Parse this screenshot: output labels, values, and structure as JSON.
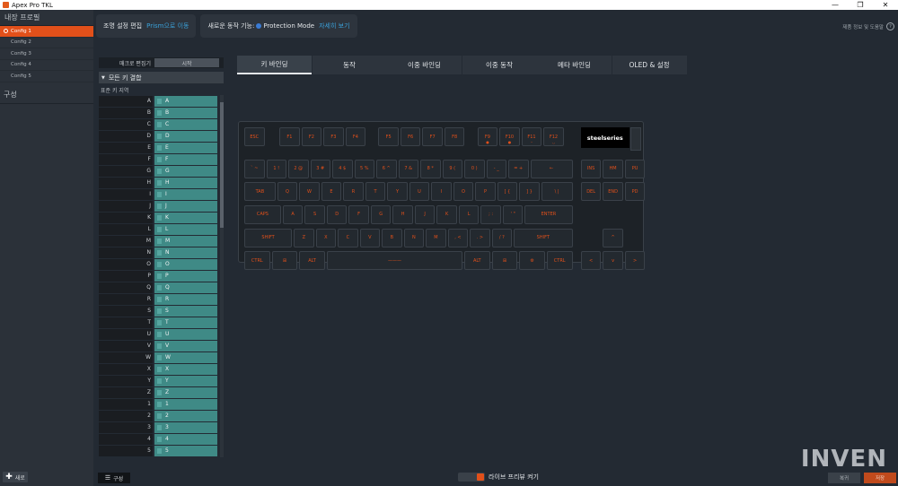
{
  "window": {
    "title": "Apex Pro TKL",
    "controls": [
      "—",
      "❐",
      "✕"
    ]
  },
  "sidebar": {
    "profiles_title": "내장 프로필",
    "configs": [
      {
        "label": "Config 1",
        "active": true
      },
      {
        "label": "Config 2",
        "active": false
      },
      {
        "label": "Config 3",
        "active": false
      },
      {
        "label": "Config 4",
        "active": false
      },
      {
        "label": "Config 5",
        "active": false
      }
    ],
    "section_config": "구성",
    "new_label": "새로"
  },
  "topbar": {
    "lighting_label": "조명 설정 편집",
    "lighting_link": "Prism으로 이동",
    "newfeature_label": "새로운 동작 기능:",
    "protection_label": "Protection Mode",
    "more_link": "자세히 보기",
    "help_label": "제품 정보 및 도움말"
  },
  "macro": {
    "editor_label": "매크로 편집기",
    "start_label": "시작",
    "combo_label": "모든 키 결합",
    "standard_label": "표준 키 지역"
  },
  "keylist": [
    {
      "key": "A",
      "bind": "A"
    },
    {
      "key": "B",
      "bind": "B"
    },
    {
      "key": "C",
      "bind": "C"
    },
    {
      "key": "D",
      "bind": "D"
    },
    {
      "key": "E",
      "bind": "E"
    },
    {
      "key": "F",
      "bind": "F"
    },
    {
      "key": "G",
      "bind": "G"
    },
    {
      "key": "H",
      "bind": "H"
    },
    {
      "key": "I",
      "bind": "I"
    },
    {
      "key": "J",
      "bind": "J"
    },
    {
      "key": "K",
      "bind": "K"
    },
    {
      "key": "L",
      "bind": "L"
    },
    {
      "key": "M",
      "bind": "M"
    },
    {
      "key": "N",
      "bind": "N"
    },
    {
      "key": "O",
      "bind": "O"
    },
    {
      "key": "P",
      "bind": "P"
    },
    {
      "key": "Q",
      "bind": "Q"
    },
    {
      "key": "R",
      "bind": "R"
    },
    {
      "key": "S",
      "bind": "S"
    },
    {
      "key": "T",
      "bind": "T"
    },
    {
      "key": "U",
      "bind": "U"
    },
    {
      "key": "V",
      "bind": "V"
    },
    {
      "key": "W",
      "bind": "W"
    },
    {
      "key": "X",
      "bind": "X"
    },
    {
      "key": "Y",
      "bind": "Y"
    },
    {
      "key": "Z",
      "bind": "Z"
    },
    {
      "key": "1",
      "bind": "1"
    },
    {
      "key": "2",
      "bind": "2"
    },
    {
      "key": "3",
      "bind": "3"
    },
    {
      "key": "4",
      "bind": "4"
    },
    {
      "key": "5",
      "bind": "5"
    }
  ],
  "tabs": [
    {
      "label": "키 바인딩",
      "active": true
    },
    {
      "label": "동작",
      "active": false
    },
    {
      "label": "이중 바인딩",
      "active": false
    },
    {
      "label": "이중 동작",
      "active": false
    },
    {
      "label": "메타 바인딩",
      "active": false
    },
    {
      "label": "OLED & 설정",
      "active": false
    }
  ],
  "keyboard": {
    "logo_text": "steelseries",
    "rows": [
      [
        {
          "label": "ESC",
          "w": 1
        },
        {
          "gap": 0.6
        },
        {
          "label": "F1",
          "w": 1
        },
        {
          "label": "F2",
          "w": 1
        },
        {
          "label": "F3",
          "w": 1
        },
        {
          "label": "F4",
          "w": 1
        },
        {
          "gap": 0.5
        },
        {
          "label": "F5",
          "w": 1
        },
        {
          "label": "F6",
          "w": 1
        },
        {
          "label": "F7",
          "w": 1
        },
        {
          "label": "F8",
          "w": 1
        },
        {
          "gap": 0.5
        },
        {
          "label": "F9",
          "w": 1,
          "sub": "●"
        },
        {
          "label": "F10",
          "w": 1,
          "sub": "●"
        },
        {
          "label": "F11",
          "w": 1,
          "sub": "–"
        },
        {
          "label": "F12",
          "w": 1,
          "sub": "◡"
        }
      ],
      [
        {
          "label": "` ~",
          "w": 1
        },
        {
          "label": "1 !",
          "w": 1
        },
        {
          "label": "2 @",
          "w": 1
        },
        {
          "label": "3 #",
          "w": 1
        },
        {
          "label": "4 $",
          "w": 1
        },
        {
          "label": "5 %",
          "w": 1
        },
        {
          "label": "6 ^",
          "w": 1
        },
        {
          "label": "7 &",
          "w": 1
        },
        {
          "label": "8 *",
          "w": 1
        },
        {
          "label": "9 (",
          "w": 1
        },
        {
          "label": "0 )",
          "w": 1
        },
        {
          "label": "- _",
          "w": 1
        },
        {
          "label": "= +",
          "w": 1
        },
        {
          "label": "←",
          "w": 2
        },
        {
          "gap": 0.3
        },
        {
          "label": "INS",
          "w": 1
        },
        {
          "label": "HM",
          "w": 1
        },
        {
          "label": "PU",
          "w": 1
        }
      ],
      [
        {
          "label": "TAB",
          "w": 1.5
        },
        {
          "label": "Q",
          "w": 1
        },
        {
          "label": "W",
          "w": 1
        },
        {
          "label": "E",
          "w": 1
        },
        {
          "label": "R",
          "w": 1
        },
        {
          "label": "T",
          "w": 1
        },
        {
          "label": "Y",
          "w": 1
        },
        {
          "label": "U",
          "w": 1
        },
        {
          "label": "I",
          "w": 1
        },
        {
          "label": "O",
          "w": 1
        },
        {
          "label": "P",
          "w": 1
        },
        {
          "label": "[ {",
          "w": 1
        },
        {
          "label": "] }",
          "w": 1
        },
        {
          "label": "\\ |",
          "w": 1.5
        },
        {
          "gap": 0.3
        },
        {
          "label": "DEL",
          "w": 1
        },
        {
          "label": "END",
          "w": 1
        },
        {
          "label": "PD",
          "w": 1
        }
      ],
      [
        {
          "label": "CAPS",
          "w": 1.75
        },
        {
          "label": "A",
          "w": 1
        },
        {
          "label": "S",
          "w": 1
        },
        {
          "label": "D",
          "w": 1
        },
        {
          "label": "F",
          "w": 1
        },
        {
          "label": "G",
          "w": 1
        },
        {
          "label": "H",
          "w": 1
        },
        {
          "label": "J",
          "w": 1
        },
        {
          "label": "K",
          "w": 1
        },
        {
          "label": "L",
          "w": 1
        },
        {
          "label": "; :",
          "w": 1
        },
        {
          "label": "' \"",
          "w": 1
        },
        {
          "label": "ENTER",
          "w": 2.25
        }
      ],
      [
        {
          "label": "SHIFT",
          "w": 2.25
        },
        {
          "label": "Z",
          "w": 1
        },
        {
          "label": "X",
          "w": 1
        },
        {
          "label": "C",
          "w": 1
        },
        {
          "label": "V",
          "w": 1
        },
        {
          "label": "B",
          "w": 1
        },
        {
          "label": "N",
          "w": 1
        },
        {
          "label": "M",
          "w": 1
        },
        {
          "label": ", <",
          "w": 1
        },
        {
          "label": ". >",
          "w": 1
        },
        {
          "label": "/ ?",
          "w": 1
        },
        {
          "label": "SHIFT",
          "w": 2.75
        },
        {
          "gap": 1.3
        },
        {
          "label": "^",
          "w": 1
        }
      ],
      [
        {
          "label": "CTRL",
          "w": 1.25
        },
        {
          "label": "⊞",
          "w": 1.25
        },
        {
          "label": "ALT",
          "w": 1.25
        },
        {
          "label": "———",
          "w": 6.25
        },
        {
          "label": "ALT",
          "w": 1.25
        },
        {
          "label": "⊞",
          "w": 1.25
        },
        {
          "label": "⚙",
          "w": 1.25
        },
        {
          "label": "CTRL",
          "w": 1.25
        },
        {
          "gap": 0.3
        },
        {
          "label": "<",
          "w": 1
        },
        {
          "label": "v",
          "w": 1
        },
        {
          "label": ">",
          "w": 1
        }
      ]
    ]
  },
  "bottom": {
    "config_button": "구성",
    "live_preview": "라이브 프리뷰 켜기",
    "back_button": "복귀",
    "save_button": "저장"
  },
  "watermark": "INVEN"
}
